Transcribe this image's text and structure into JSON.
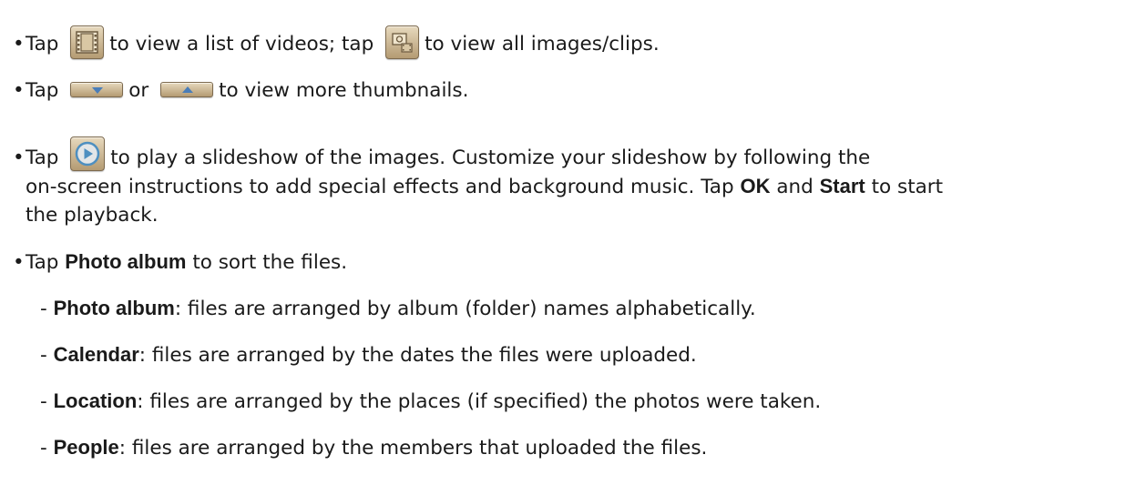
{
  "icons": [
    "film-icon",
    "image-clip-icon",
    "arrow-down-icon",
    "arrow-up-icon",
    "play-icon"
  ],
  "lines": {
    "l1": {
      "a": "Tap",
      "b": "to view a list of videos; tap",
      "c": "to view all images/clips."
    },
    "l2": {
      "a": "Tap",
      "b": "or",
      "c": "to view more thumbnails."
    },
    "l3": {
      "a": "Tap",
      "b": "to play a slideshow of the images. Customize your slideshow by following the"
    },
    "l4": {
      "a": "on-screen instructions to add special effects and background music. Tap",
      "ok": "OK",
      "and": "and",
      "start": "Start",
      "c": "to start"
    },
    "l5": {
      "a": "the playback."
    },
    "l6": {
      "a": "Tap",
      "bold": "Photo album",
      "c": "to sort the files."
    },
    "l7": {
      "dash": "-",
      "bold": "Photo album",
      "c": ": files are arranged by album (folder) names alphabetically."
    },
    "l8": {
      "dash": "-",
      "bold": "Calendar",
      "c": ": files are arranged by the dates the files were uploaded."
    },
    "l9": {
      "dash": "-",
      "bold": "Location",
      "c": ": files are arranged by the places (if specified) the photos were taken."
    },
    "l10": {
      "dash": "-",
      "bold": "People",
      "c": ": files are arranged by the members that uploaded the files."
    }
  },
  "bullet": "•"
}
